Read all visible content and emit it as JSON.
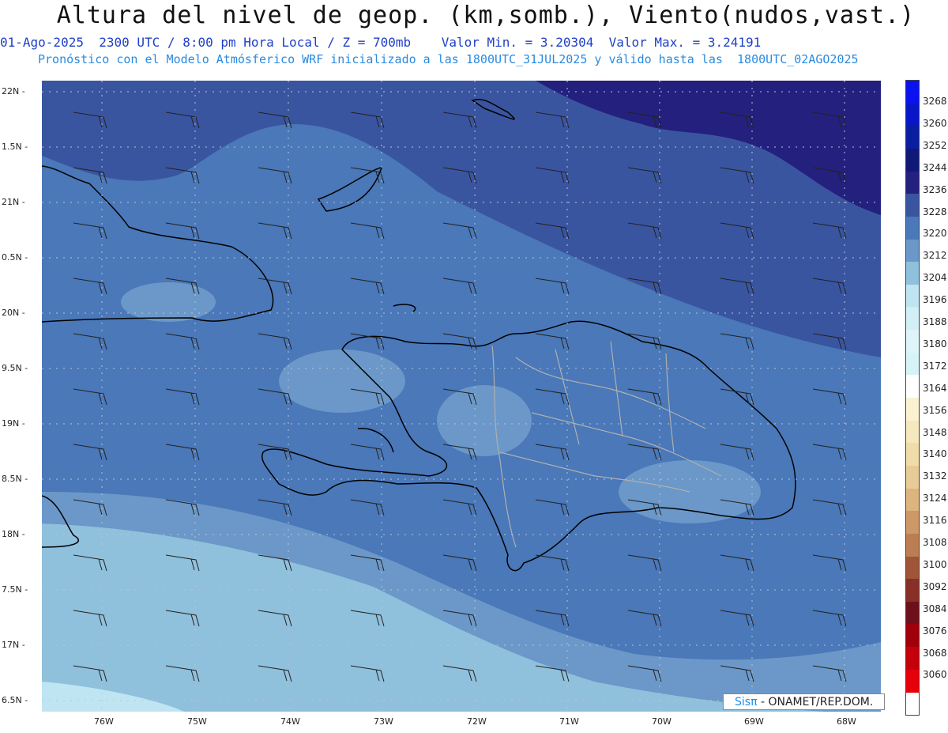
{
  "header": {
    "title": "Altura del nivel de geop. (km,somb.), Viento(nudos,vast.)",
    "line2": "01-Ago-2025  2300 UTC / 8:00 pm Hora Local / Z = 700mb    Valor Min. = 3.20304  Valor Max. = 3.24191",
    "line3": "Pronóstico con el Modelo Atmósferico WRF inicializado a las 1800UTC_31JUL2025 y válido hasta las  1800UTC_02AGO2025"
  },
  "axes": {
    "lat_labels": [
      "22N",
      "1.5N",
      "21N",
      "0.5N",
      "20N",
      "9.5N",
      "19N",
      "8.5N",
      "18N",
      "7.5N",
      "17N",
      "6.5N"
    ],
    "lon_labels": [
      "76W",
      "75W",
      "74W",
      "73W",
      "72W",
      "71W",
      "70W",
      "69W",
      "68W"
    ]
  },
  "colorbar": {
    "labels": [
      "3268",
      "3260",
      "3252",
      "3244",
      "3236",
      "3228",
      "3220",
      "3212",
      "3204",
      "3196",
      "3188",
      "3180",
      "3172",
      "3164",
      "3156",
      "3148",
      "3140",
      "3132",
      "3124",
      "3116",
      "3108",
      "3100",
      "3092",
      "3084",
      "3076",
      "3068",
      "3060"
    ],
    "colors": [
      "#0a12f0",
      "#0816c8",
      "#0a1ea0",
      "#101878",
      "#24207e",
      "#3a55a0",
      "#4a78b8",
      "#6b98c8",
      "#8fc0dc",
      "#bfe5f2",
      "#d2eef6",
      "#dff4f9",
      "#d6f4f7",
      "#ffffff",
      "#faf2d0",
      "#f5e8bd",
      "#f0dcaa",
      "#e8cc98",
      "#ddb47e",
      "#cc9866",
      "#bb7e52",
      "#a05438",
      "#883028",
      "#6e101c",
      "#a0000a",
      "#c4000a",
      "#e6000a"
    ]
  },
  "map_colors": {
    "dark": "#24207e",
    "deep": "#3a55a0",
    "mid": "#4a78b8",
    "light": "#6b98c8",
    "pale": "#8fc0dc",
    "palest": "#bfe5f2",
    "coast": "#000000",
    "border": "#b0b0b0"
  },
  "credit": {
    "brand": "Sisπ",
    "text": " - ONAMET/REP.DOM."
  }
}
